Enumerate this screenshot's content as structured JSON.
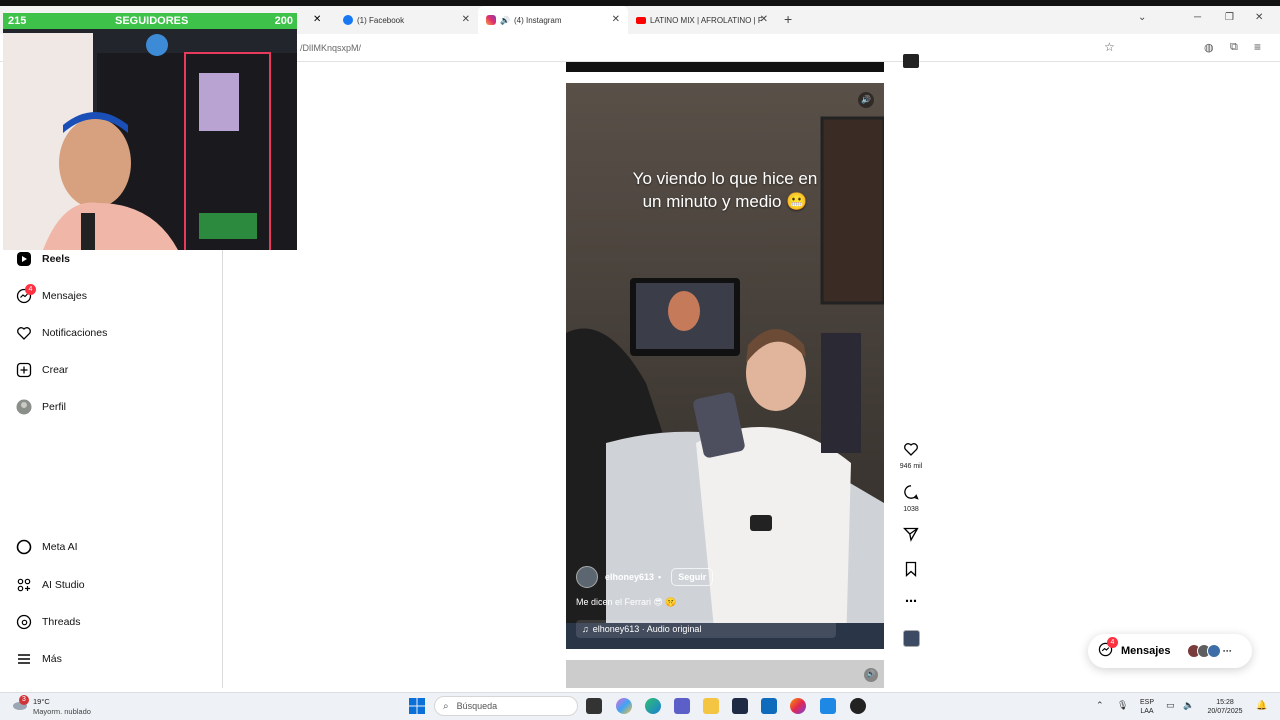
{
  "tabs": [
    {
      "label": "(1) Facebook",
      "icon": "facebook-icon"
    },
    {
      "label": "(4) Instagram",
      "icon": "instagram-icon",
      "active": true
    },
    {
      "label": "LATINO MIX | AFROLATINO | PC",
      "icon": "youtube-icon"
    }
  ],
  "url": "/DlIMKnqsxpM/",
  "overlay": {
    "left_count": "215",
    "title": "SEGUIDORES",
    "right_count": "200"
  },
  "sidebar": {
    "items": [
      {
        "label": "Reels",
        "icon": "reels-icon",
        "bold": true
      },
      {
        "label": "Mensajes",
        "icon": "messenger-icon",
        "badge": "4"
      },
      {
        "label": "Notificaciones",
        "icon": "heart-icon"
      },
      {
        "label": "Crear",
        "icon": "plus-square-icon"
      },
      {
        "label": "Perfil",
        "icon": "profile-avatar"
      },
      {
        "label": "Meta AI",
        "icon": "meta-ai-icon"
      },
      {
        "label": "AI Studio",
        "icon": "ai-studio-icon"
      },
      {
        "label": "Threads",
        "icon": "threads-icon"
      },
      {
        "label": "Más",
        "icon": "menu-icon"
      }
    ]
  },
  "reel": {
    "caption_line1": "Yo viendo lo que hice en",
    "caption_line2": "un minuto y medio 😬",
    "username": "elhoney613",
    "separator": "•",
    "follow_label": "Seguir",
    "description": "Me dicen el Ferrari 😎 🤫",
    "audio": "elhoney613 · Audio original"
  },
  "actions": {
    "likes": "946 mil",
    "comments": "1038"
  },
  "messages": {
    "label": "Mensajes",
    "badge": "4"
  },
  "taskbar": {
    "weather_temp": "19°C",
    "weather_desc": "Mayorm. nublado",
    "weather_badge": "3",
    "search_placeholder": "Búsqueda",
    "lang_top": "ESP",
    "lang_bottom": "LAA",
    "time": "15:28",
    "date": "20/07/2025"
  },
  "colors": {
    "overlay_green": "#3ec24a",
    "badge_red": "#ff3040",
    "accent": "#0095f6"
  }
}
